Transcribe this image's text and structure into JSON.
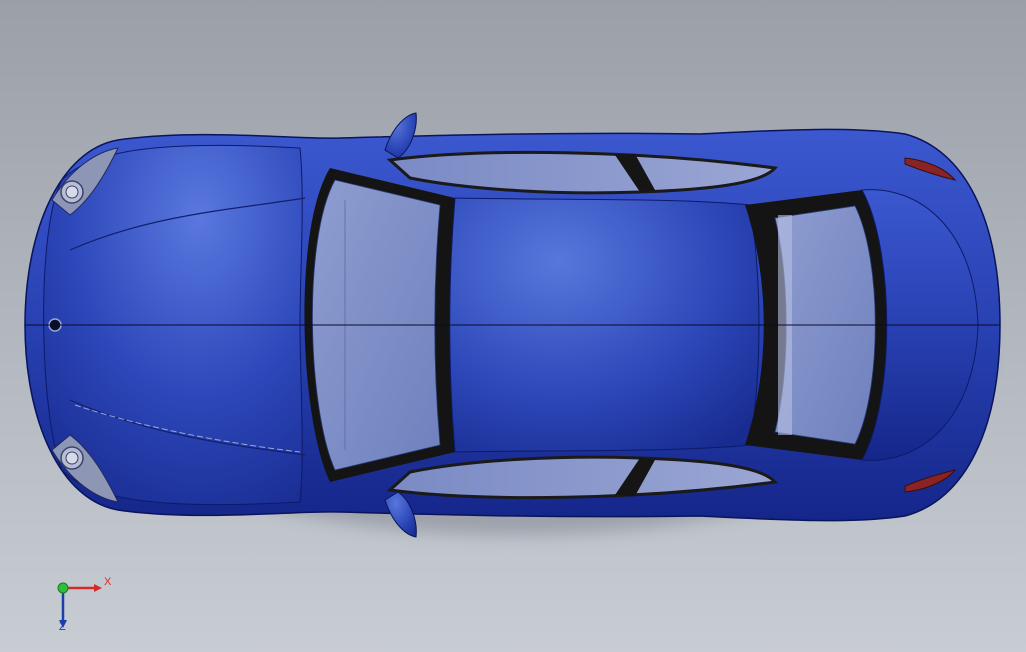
{
  "viewport": {
    "background_top": "#9ba0a8",
    "background_bottom": "#c8ccd3"
  },
  "model": {
    "icon": "car-body-top-view",
    "body_color": "#2b46b8",
    "body_dark": "#0f1f6e",
    "body_light": "#5f7ee0",
    "glass_color": "#7f8fc4",
    "frame_color": "#151515"
  },
  "triad": {
    "icon": "coordinate-triad-icon",
    "x_label": "X",
    "z_label": "Z",
    "x_color": "#d42a2a",
    "y_color": "#2fbf3a",
    "z_color": "#1b3fa8"
  }
}
